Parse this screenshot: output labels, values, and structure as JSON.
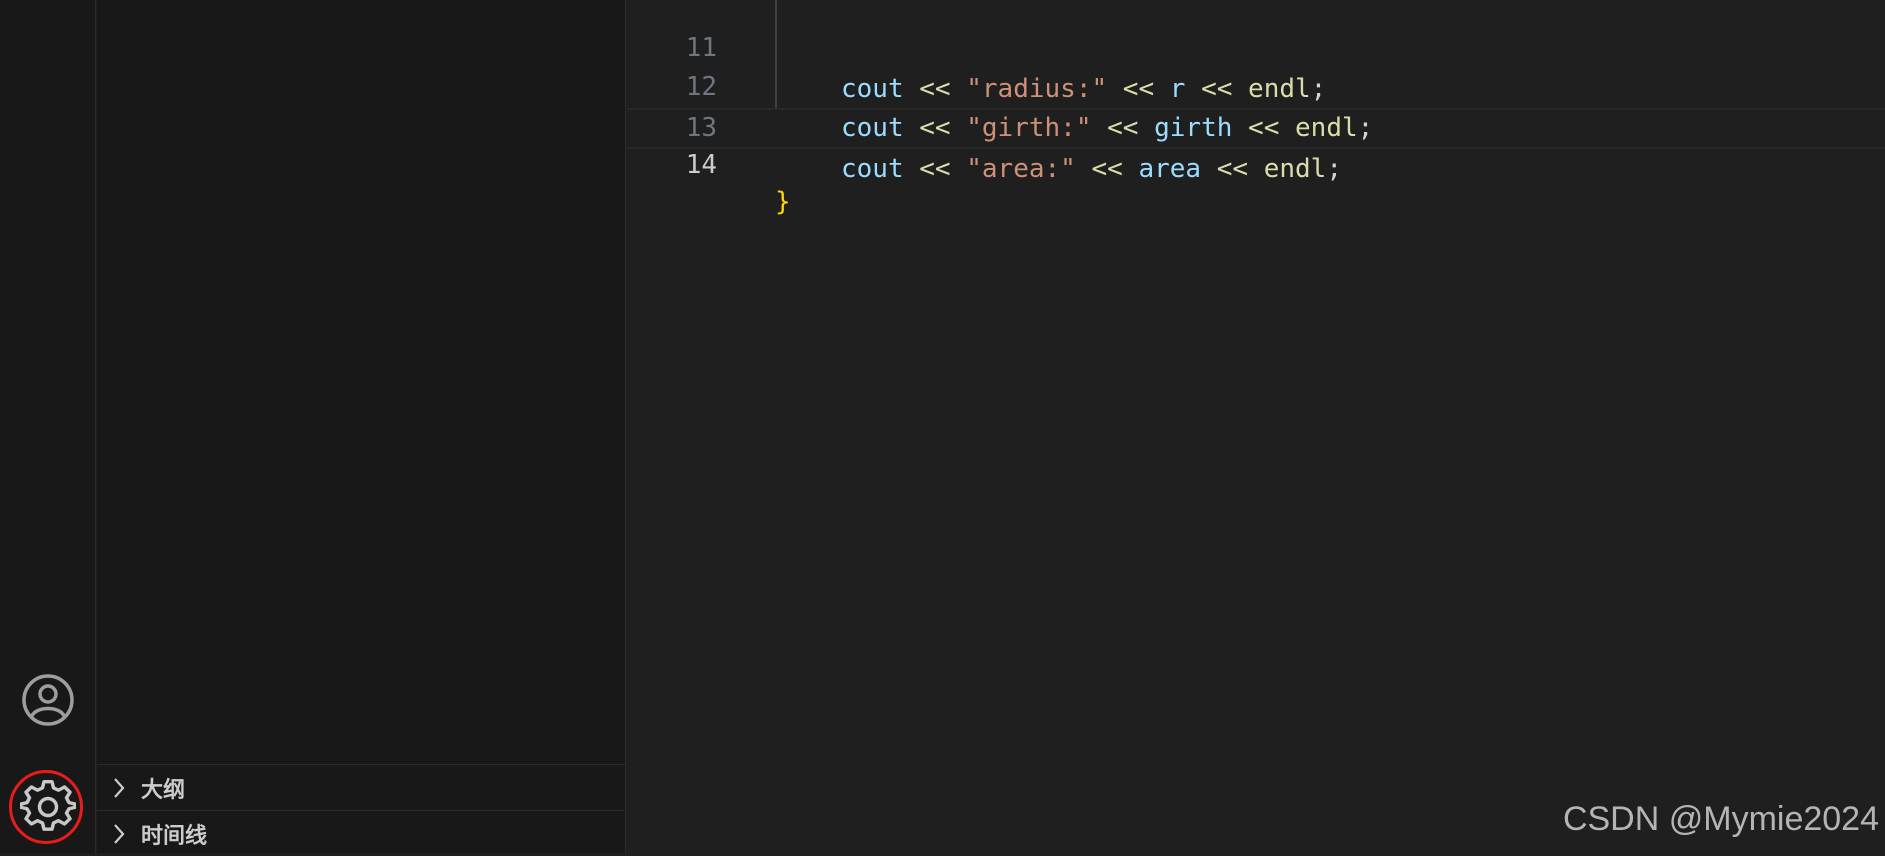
{
  "colors": {
    "background": "#1f1f1f",
    "sidebar": "#181818",
    "variable": "#9cdcfe",
    "string": "#ce9178",
    "function": "#dcdcaa",
    "brace": "#ffd700",
    "highlight_ring": "#e81c1c"
  },
  "activity_bar": {
    "account_icon": "account-icon",
    "settings_icon": "gear-icon"
  },
  "sidebar": {
    "sections": [
      {
        "label": "大纲",
        "icon": "chevron-right-icon"
      },
      {
        "label": "时间线",
        "icon": "chevron-right-icon"
      }
    ]
  },
  "editor": {
    "current_line": "14",
    "lines": [
      {
        "number": "11",
        "tokens": [
          "cout",
          " << ",
          "\"radius:\"",
          " << ",
          "r",
          " << ",
          "endl",
          ";"
        ]
      },
      {
        "number": "12",
        "tokens": [
          "cout",
          " << ",
          "\"girth:\"",
          " << ",
          "girth",
          " << ",
          "endl",
          ";"
        ]
      },
      {
        "number": "13",
        "tokens": [
          "cout",
          " << ",
          "\"area:\"",
          " << ",
          "area",
          " << ",
          "endl",
          ";"
        ]
      },
      {
        "number": "14",
        "tokens": [
          "}"
        ]
      }
    ]
  },
  "watermark": "CSDN @Mymie2024"
}
